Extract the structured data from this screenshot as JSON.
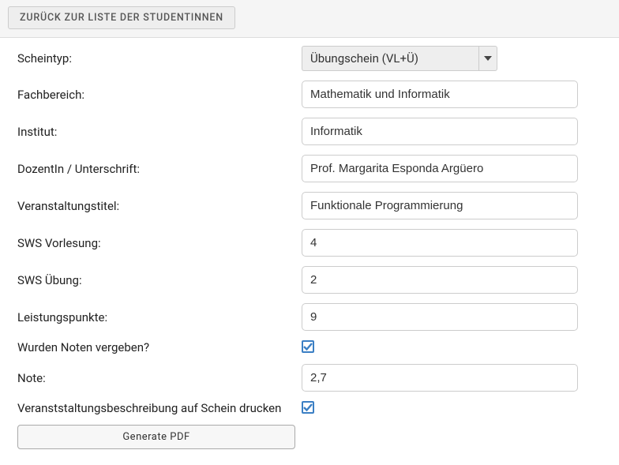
{
  "topbar": {
    "back_label": "ZURÜCK ZUR LISTE DER STUDENTINNEN"
  },
  "form": {
    "scheintyp": {
      "label": "Scheintyp:",
      "value": "Übungschein (VL+Ü)"
    },
    "fachbereich": {
      "label": "Fachbereich:",
      "value": "Mathematik und Informatik"
    },
    "institut": {
      "label": "Institut:",
      "value": "Informatik"
    },
    "dozent": {
      "label": "DozentIn / Unterschrift:",
      "value": "Prof. Margarita Esponda Argüero"
    },
    "titel": {
      "label": "Veranstaltungstitel:",
      "value": "Funktionale Programmierung"
    },
    "sws_vorlesung": {
      "label": "SWS Vorlesung:",
      "value": "4"
    },
    "sws_uebung": {
      "label": "SWS Übung:",
      "value": "2"
    },
    "lp": {
      "label": "Leistungspunkte:",
      "value": "9"
    },
    "noten_vergeben": {
      "label": "Wurden Noten vergeben?",
      "checked": true
    },
    "note": {
      "label": "Note:",
      "value": "2,7"
    },
    "beschreibung_drucken": {
      "label": "Veranststaltungsbeschreibung auf Schein drucken",
      "checked": true
    },
    "generate_label": "Generate PDF"
  }
}
